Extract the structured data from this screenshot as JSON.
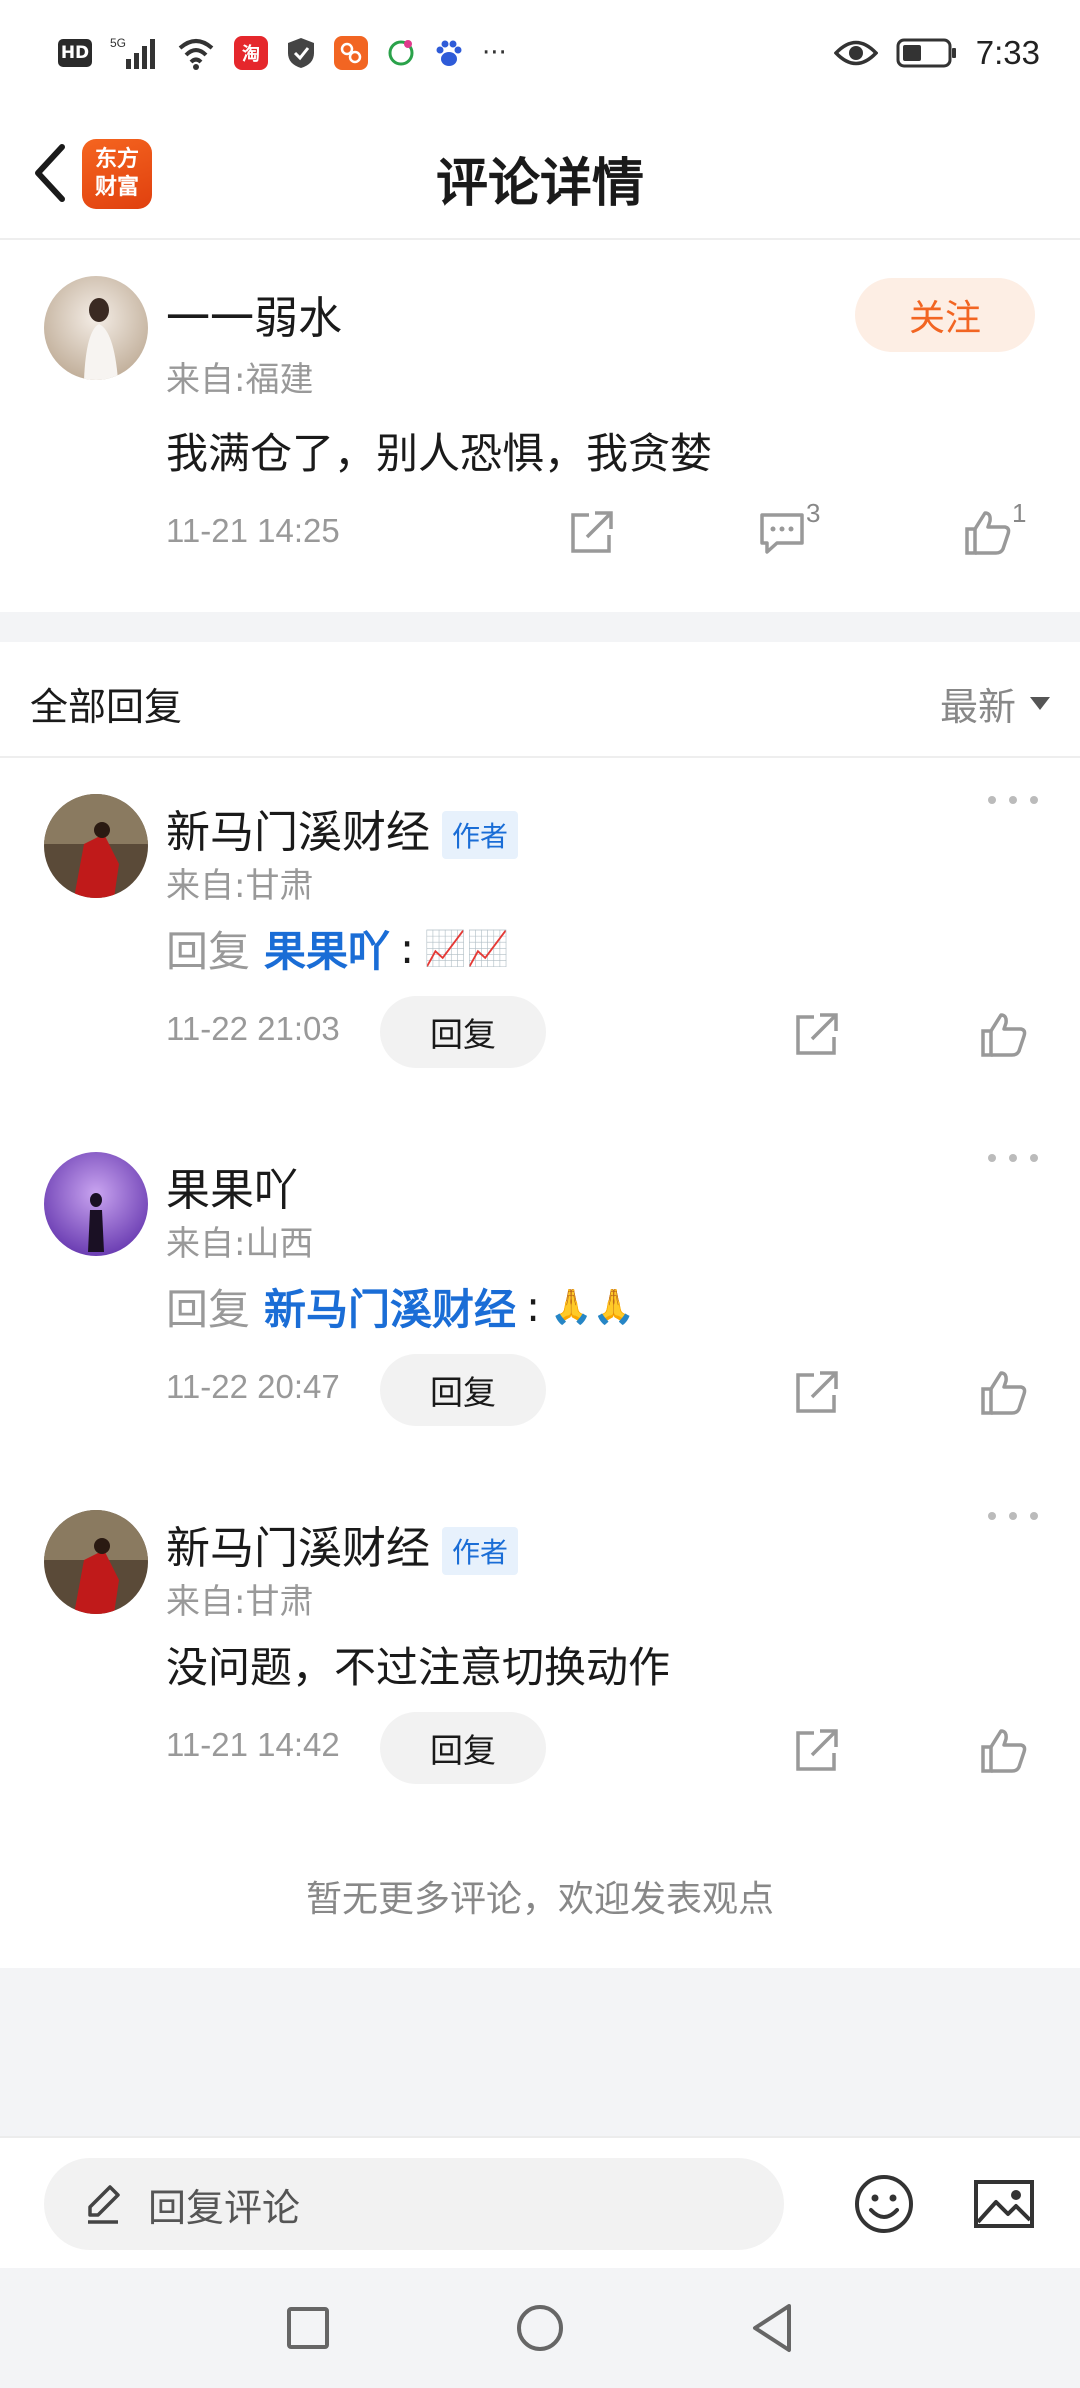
{
  "status_bar": {
    "hd": "HD",
    "signal": "5G",
    "more": "···",
    "time": "7:33"
  },
  "header": {
    "title": "评论详情",
    "logo_line1": "东方",
    "logo_line2": "财富"
  },
  "main_comment": {
    "name": "一一弱水",
    "origin": "来自:福建",
    "follow_label": "关注",
    "text": "我满仓了，别人恐惧，我贪婪",
    "timestamp": "11-21 14:25",
    "reply_count": "3",
    "like_count": "1"
  },
  "replies_section": {
    "title": "全部回复",
    "sort_label": "最新"
  },
  "replies": [
    {
      "name": "新马门溪财经",
      "author_tag": "作者",
      "origin": "来自:甘肃",
      "reply_prefix": "回复",
      "reply_target": "果果吖",
      "colon": ":",
      "emoji_text": "📈📈",
      "timestamp": "11-22 21:03",
      "reply_label": "回复"
    },
    {
      "name": "果果吖",
      "origin": "来自:山西",
      "reply_prefix": "回复",
      "reply_target": "新马门溪财经",
      "colon": ":",
      "emoji_text": "🙏🙏",
      "timestamp": "11-22 20:47",
      "reply_label": "回复"
    },
    {
      "name": "新马门溪财经",
      "author_tag": "作者",
      "origin": "来自:甘肃",
      "text": "没问题，不过注意切换动作",
      "timestamp": "11-21 14:42",
      "reply_label": "回复"
    }
  ],
  "footer_note": "暂无更多评论，欢迎发表观点",
  "input_bar": {
    "placeholder": "回复评论"
  },
  "colors": {
    "accent": "#f26522",
    "link_blue": "#1a6dd6",
    "muted": "#999999"
  }
}
